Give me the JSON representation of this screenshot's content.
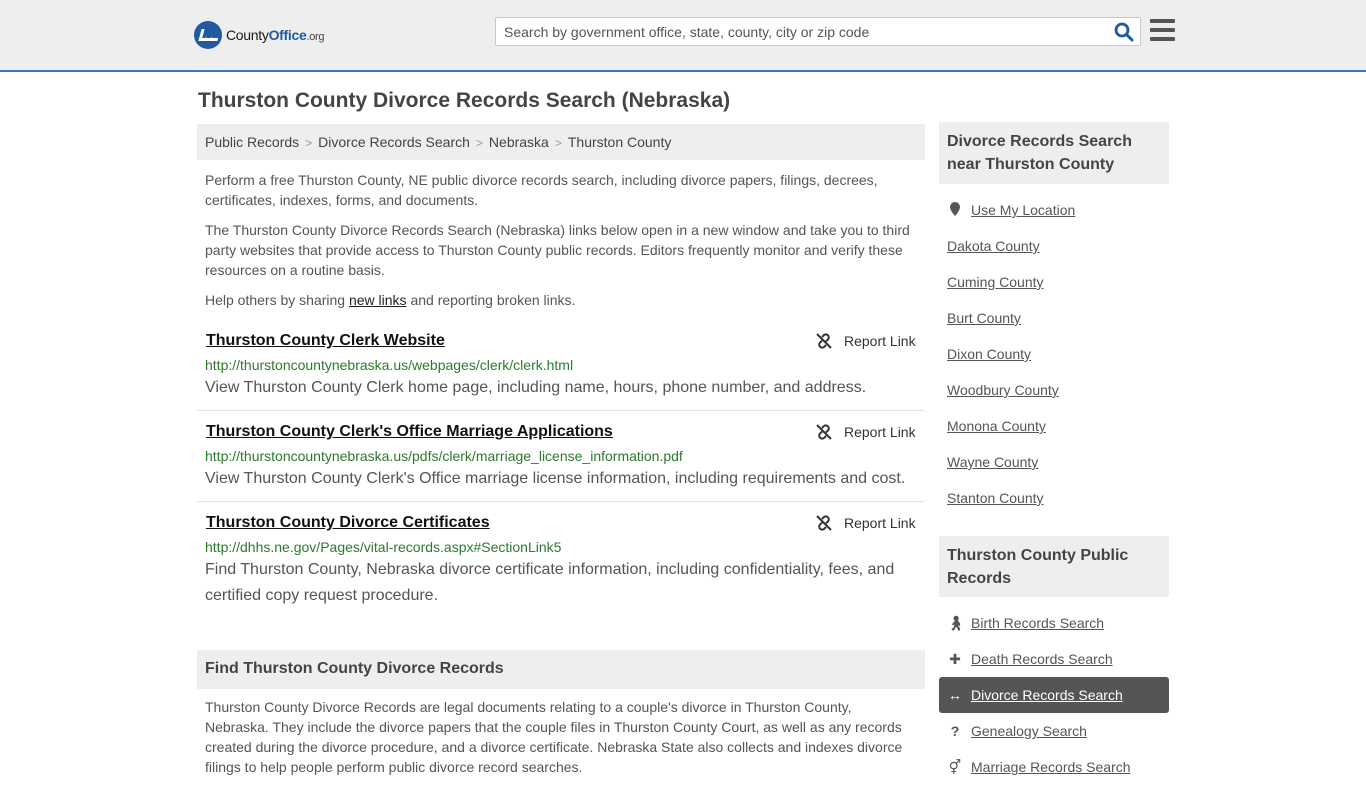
{
  "header": {
    "logo_main": "County",
    "logo_brand": "Office",
    "logo_tld": ".org",
    "search_placeholder": "Search by government office, state, county, city or zip code"
  },
  "page_title": "Thurston County Divorce Records Search (Nebraska)",
  "breadcrumb": [
    "Public Records",
    "Divorce Records Search",
    "Nebraska",
    "Thurston County"
  ],
  "intro": {
    "p1": "Perform a free Thurston County, NE public divorce records search, including divorce papers, filings, decrees, certificates, indexes, forms, and documents.",
    "p2": "The Thurston County Divorce Records Search (Nebraska) links below open in a new window and take you to third party websites that provide access to Thurston County public records. Editors frequently monitor and verify these resources on a routine basis.",
    "p3_before": "Help others by sharing ",
    "p3_link": "new links",
    "p3_after": " and reporting broken links."
  },
  "report_label": "Report Link",
  "results": [
    {
      "title": "Thurston County Clerk Website",
      "url": "http://thurstoncountynebraska.us/webpages/clerk/clerk.html",
      "desc": "View Thurston County Clerk home page, including name, hours, phone number, and address."
    },
    {
      "title": "Thurston County Clerk's Office Marriage Applications",
      "url": "http://thurstoncountynebraska.us/pdfs/clerk/marriage_license_information.pdf",
      "desc": "View Thurston County Clerk's Office marriage license information, including requirements and cost."
    },
    {
      "title": "Thurston County Divorce Certificates",
      "url": "http://dhhs.ne.gov/Pages/vital-records.aspx#SectionLink5",
      "desc": "Find Thurston County, Nebraska divorce certificate information, including confidentiality, fees, and certified copy request procedure."
    }
  ],
  "find_section": {
    "title": "Find Thurston County Divorce Records",
    "body": "Thurston County Divorce Records are legal documents relating to a couple's divorce in Thurston County, Nebraska. They include the divorce papers that the couple files in Thurston County Court, as well as any records created during the divorce procedure, and a divorce certificate. Nebraska State also collects and indexes divorce filings to help people perform public divorce record searches."
  },
  "sidebar": {
    "nearby_title": "Divorce Records Search near Thurston County",
    "use_location": "Use My Location",
    "nearby": [
      "Dakota County",
      "Cuming County",
      "Burt County",
      "Dixon County",
      "Woodbury County",
      "Monona County",
      "Wayne County",
      "Stanton County"
    ],
    "public_title": "Thurston County Public Records",
    "public": [
      {
        "label": "Birth Records Search",
        "icon": "person-icon"
      },
      {
        "label": "Death Records Search",
        "icon": "cross-icon"
      },
      {
        "label": "Divorce Records Search",
        "icon": "split-arrows-icon"
      },
      {
        "label": "Genealogy Search",
        "icon": "question-icon"
      },
      {
        "label": "Marriage Records Search",
        "icon": "gender-rings-icon"
      }
    ]
  }
}
